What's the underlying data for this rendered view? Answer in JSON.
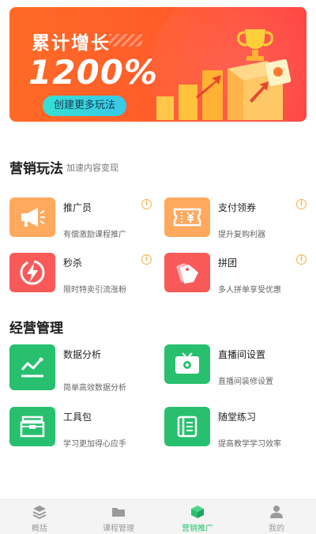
{
  "banner": {
    "title": "累计增长",
    "number": "1200%",
    "cta": "创建更多玩法"
  },
  "marketing": {
    "title": "营销玩法",
    "subtitle": "加速内容变现",
    "items": [
      {
        "name": "推广员",
        "desc": "有偿激励课程推广"
      },
      {
        "name": "支付领券",
        "desc": "提升复购利器"
      },
      {
        "name": "秒杀",
        "desc": "限时特卖引流涨粉"
      },
      {
        "name": "拼团",
        "desc": "多人拼单享受优惠"
      }
    ]
  },
  "operations": {
    "title": "经营管理",
    "items": [
      {
        "name": "数据分析",
        "desc": "简单高效数据分析"
      },
      {
        "name": "直播间设置",
        "desc": "直播间装修设置"
      },
      {
        "name": "工具包",
        "desc": "学习更加得心应手"
      },
      {
        "name": "随堂练习",
        "desc": "提高教学学习效率"
      }
    ]
  },
  "info_glyph": "i",
  "nav": {
    "items": [
      {
        "label": "概括"
      },
      {
        "label": "课程管理"
      },
      {
        "label": "营销推广"
      },
      {
        "label": "我的"
      }
    ],
    "active": "营销推广"
  },
  "colors": {
    "accent": "#28c06f",
    "banner_start": "#ff6a26",
    "banner_end": "#ff3d3a",
    "tile_orange": "#ffa95e",
    "tile_red": "#f85a5a",
    "tile_green": "#28c06f"
  },
  "icons": {
    "promoter": "megaphone-icon",
    "coupon": "ticket-icon",
    "flash_sale": "lightning-icon",
    "group_buy": "tag-icon",
    "analytics": "line-chart-icon",
    "live_settings": "tv-gear-icon",
    "toolkit": "toolbox-icon",
    "exercise": "notebook-icon"
  }
}
